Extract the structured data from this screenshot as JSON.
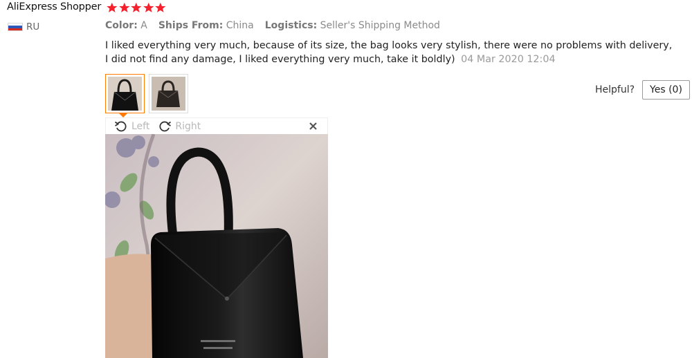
{
  "review": {
    "user_name": "AliExpress Shopper",
    "rating": 5,
    "country_code": "RU",
    "meta": [
      {
        "key": "Color:",
        "value": "A"
      },
      {
        "key": "Ships From:",
        "value": "China"
      },
      {
        "key": "Logistics:",
        "value": "Seller's Shipping Method"
      }
    ],
    "text": "I liked everything very much, because of its size, the bag looks very stylish, there were no problems with delivery, I did not find any damage, I liked everything very much, take it boldly)",
    "date": "04 Mar 2020 12:04"
  },
  "viewer": {
    "rotate_left_label": "Left",
    "rotate_right_label": "Right"
  },
  "helpful": {
    "label": "Helpful?",
    "button_label": "Yes (0)"
  },
  "colors": {
    "star": "#f5222d",
    "active_border": "#ff7a00",
    "muted_text": "#9a9a9a"
  },
  "icons": [
    "star-icon",
    "russia-flag-icon",
    "rotate-left-icon",
    "rotate-right-icon",
    "close-icon"
  ]
}
